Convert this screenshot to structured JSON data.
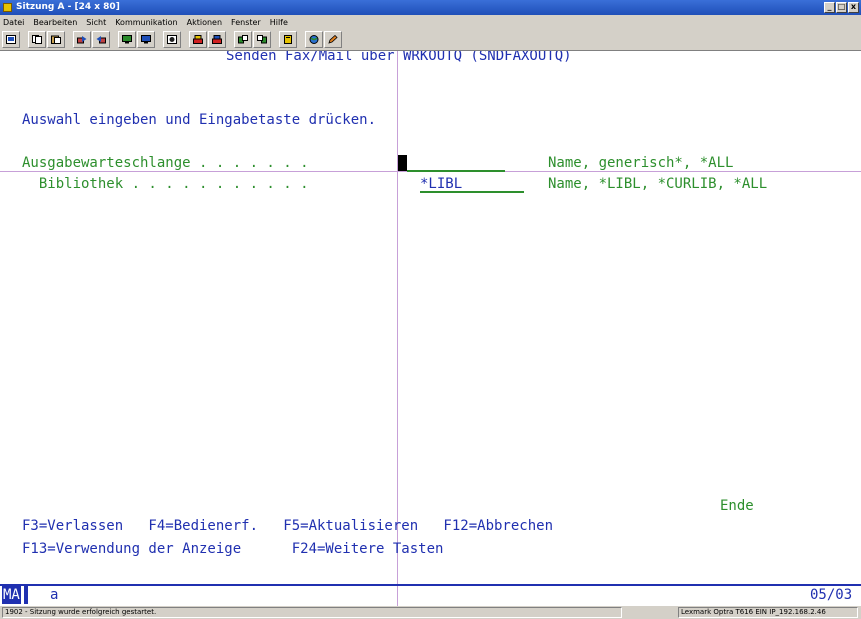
{
  "window": {
    "title": "Sitzung A - [24 x 80]",
    "controls": [
      "_",
      "□",
      "x"
    ]
  },
  "menu": [
    "Datei",
    "Bearbeiten",
    "Sicht",
    "Kommunikation",
    "Aktionen",
    "Fenster",
    "Hilfe"
  ],
  "toolbar": {
    "icons": [
      "print-screen-icon",
      "copy-icon",
      "paste-icon",
      "send-icon",
      "receive-icon",
      "display-icon",
      "keyboard-icon",
      "record-icon",
      "macro-red-icon",
      "macro-play-icon",
      "transfer-send-icon",
      "transfer-receive-icon",
      "clipboard-icon",
      "globe-icon",
      "pencil-icon"
    ]
  },
  "screen": {
    "heading": "Senden Fax/Mail über WRKOUTQ (SNDFAXOUTQ)",
    "instruction": "Auswahl eingeben und Eingabetaste drücken.",
    "fields": [
      {
        "label": "Ausgabewarteschlange . . . . . . .",
        "value": "",
        "hint": "Name, generisch*, *ALL"
      },
      {
        "label": "  Bibliothek . . . . . . . . . . .",
        "value": "*LIBL",
        "hint": "Name, *LIBL, *CURLIB, *ALL"
      }
    ],
    "more_indicator": "Ende",
    "function_keys_line1": "F3=Verlassen   F4=Bedienerf.   F5=Aktualisieren   F12=Abbrechen",
    "function_keys_line2": "F13=Verwendung der Anzeige      F24=Weitere Tasten"
  },
  "oia": {
    "indicator": "MA",
    "session_letter": "a",
    "cursor_position": "05/03"
  },
  "statusbar": {
    "message": "1902 - Sitzung wurde erfolgreich gestartet.",
    "printer": "Lexmark Optra T616 EIN IP_192.168.2.46"
  },
  "colors": {
    "field_text": "#2030b0",
    "protected_text": "#2d8f2d",
    "crosshair": "#c7a0d8"
  }
}
